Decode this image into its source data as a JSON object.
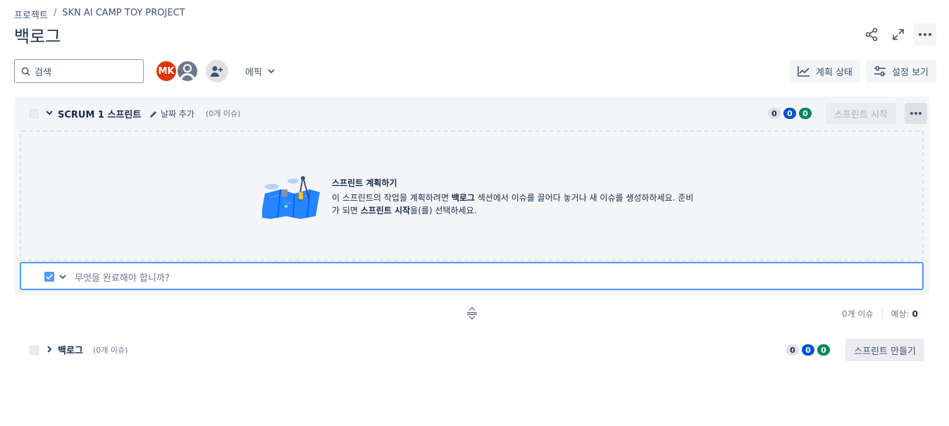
{
  "breadcrumb": {
    "project": "프로젝트",
    "separator": "/",
    "name": "SKN AI CAMP TOY PROJECT"
  },
  "page": {
    "title": "백로그"
  },
  "toolbar": {
    "search_placeholder": "검색",
    "avatar_initials": "MK",
    "epic_label": "에픽",
    "plan_status_label": "계획 상태",
    "view_settings_label": "설정 보기"
  },
  "sprint": {
    "name": "SCRUM 1 스프린트",
    "add_date": "날짜 추가",
    "issue_count": "(0개 이슈)",
    "counts": {
      "todo": "0",
      "in_progress": "0",
      "done": "0"
    },
    "start_label": "스프린트 시작",
    "empty_title": "스프린트 계획하기",
    "empty_body": {
      "p1": "이 스프린트의 작업을 계획하려면 ",
      "b1": "백로그",
      "p2": " 섹션에서 이슈를 끌어다 놓거나 새 이슈를 생성하하세요. 준비가 되면 ",
      "b2": "스프린트 시작",
      "p3": "을(를) 선택하세요."
    },
    "create_placeholder": "무엇을 완료해야 합니까?"
  },
  "summary": {
    "issues": "0개 이슈",
    "estimate_label": "예상:",
    "estimate_value": "0"
  },
  "backlog": {
    "name": "백로그",
    "issue_count": "(0개 이슈)",
    "counts": {
      "todo": "0",
      "in_progress": "0",
      "done": "0"
    },
    "create_sprint_label": "스프린트 만들기"
  },
  "colors": {
    "accent": "#0052cc",
    "avatar_mk": "#de350b",
    "done": "#00875a",
    "focus": "#4c9aff"
  }
}
